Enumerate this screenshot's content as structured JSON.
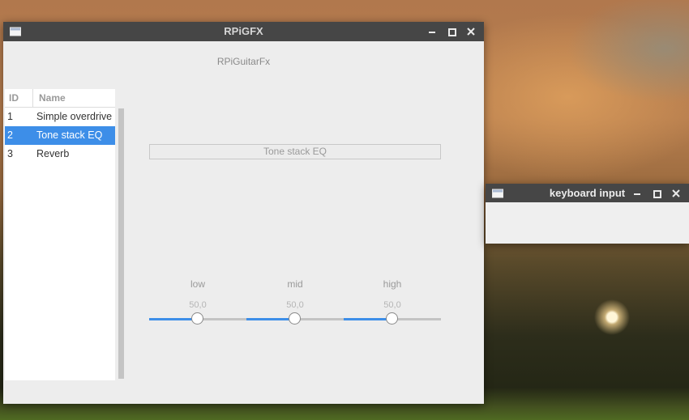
{
  "main_window": {
    "title": "RPiGFX",
    "app_heading": "RPiGuitarFx",
    "effects_table": {
      "columns": [
        "ID",
        "Name"
      ],
      "rows": [
        {
          "id": "1",
          "name": "Simple overdrive"
        },
        {
          "id": "2",
          "name": "Tone stack EQ"
        },
        {
          "id": "3",
          "name": "Reverb"
        }
      ],
      "selected_index": 1
    },
    "effect_name": "Tone stack EQ",
    "sliders": [
      {
        "label": "low",
        "value_text": "50,0",
        "level": 0.5
      },
      {
        "label": "mid",
        "value_text": "50,0",
        "level": 0.5
      },
      {
        "label": "high",
        "value_text": "50,0",
        "level": 0.5
      }
    ]
  },
  "keyboard_window": {
    "title": "keyboard input"
  },
  "colors": {
    "titlebar": "#464646",
    "accent": "#3d8ee8",
    "window_bg": "#ededed"
  },
  "icons": [
    "app-window-icon",
    "minimize-icon",
    "maximize-icon",
    "close-icon"
  ]
}
